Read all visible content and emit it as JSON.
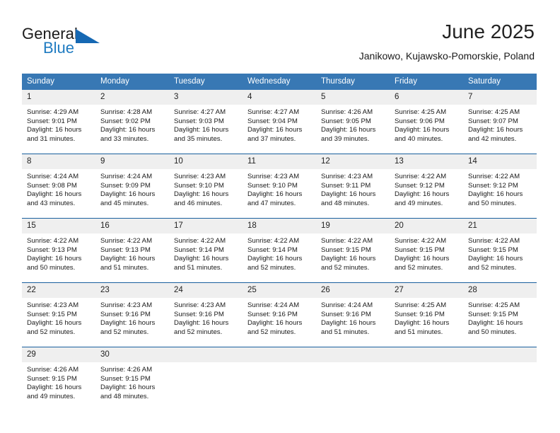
{
  "brand": {
    "name_part1": "General",
    "name_part2": "Blue",
    "accent_color": "#1668b3"
  },
  "header": {
    "title": "June 2025",
    "subtitle": "Janikowo, Kujawsko-Pomorskie, Poland"
  },
  "theme": {
    "header_row_bg": "#3878b4",
    "date_band_bg": "#efefef",
    "row_divider": "#195f9e"
  },
  "weekdays": [
    "Sunday",
    "Monday",
    "Tuesday",
    "Wednesday",
    "Thursday",
    "Friday",
    "Saturday"
  ],
  "weeks": [
    {
      "days": [
        {
          "date": "1",
          "sunrise": "Sunrise: 4:29 AM",
          "sunset": "Sunset: 9:01 PM",
          "daylight_line1": "Daylight: 16 hours",
          "daylight_line2": "and 31 minutes."
        },
        {
          "date": "2",
          "sunrise": "Sunrise: 4:28 AM",
          "sunset": "Sunset: 9:02 PM",
          "daylight_line1": "Daylight: 16 hours",
          "daylight_line2": "and 33 minutes."
        },
        {
          "date": "3",
          "sunrise": "Sunrise: 4:27 AM",
          "sunset": "Sunset: 9:03 PM",
          "daylight_line1": "Daylight: 16 hours",
          "daylight_line2": "and 35 minutes."
        },
        {
          "date": "4",
          "sunrise": "Sunrise: 4:27 AM",
          "sunset": "Sunset: 9:04 PM",
          "daylight_line1": "Daylight: 16 hours",
          "daylight_line2": "and 37 minutes."
        },
        {
          "date": "5",
          "sunrise": "Sunrise: 4:26 AM",
          "sunset": "Sunset: 9:05 PM",
          "daylight_line1": "Daylight: 16 hours",
          "daylight_line2": "and 39 minutes."
        },
        {
          "date": "6",
          "sunrise": "Sunrise: 4:25 AM",
          "sunset": "Sunset: 9:06 PM",
          "daylight_line1": "Daylight: 16 hours",
          "daylight_line2": "and 40 minutes."
        },
        {
          "date": "7",
          "sunrise": "Sunrise: 4:25 AM",
          "sunset": "Sunset: 9:07 PM",
          "daylight_line1": "Daylight: 16 hours",
          "daylight_line2": "and 42 minutes."
        }
      ]
    },
    {
      "days": [
        {
          "date": "8",
          "sunrise": "Sunrise: 4:24 AM",
          "sunset": "Sunset: 9:08 PM",
          "daylight_line1": "Daylight: 16 hours",
          "daylight_line2": "and 43 minutes."
        },
        {
          "date": "9",
          "sunrise": "Sunrise: 4:24 AM",
          "sunset": "Sunset: 9:09 PM",
          "daylight_line1": "Daylight: 16 hours",
          "daylight_line2": "and 45 minutes."
        },
        {
          "date": "10",
          "sunrise": "Sunrise: 4:23 AM",
          "sunset": "Sunset: 9:10 PM",
          "daylight_line1": "Daylight: 16 hours",
          "daylight_line2": "and 46 minutes."
        },
        {
          "date": "11",
          "sunrise": "Sunrise: 4:23 AM",
          "sunset": "Sunset: 9:10 PM",
          "daylight_line1": "Daylight: 16 hours",
          "daylight_line2": "and 47 minutes."
        },
        {
          "date": "12",
          "sunrise": "Sunrise: 4:23 AM",
          "sunset": "Sunset: 9:11 PM",
          "daylight_line1": "Daylight: 16 hours",
          "daylight_line2": "and 48 minutes."
        },
        {
          "date": "13",
          "sunrise": "Sunrise: 4:22 AM",
          "sunset": "Sunset: 9:12 PM",
          "daylight_line1": "Daylight: 16 hours",
          "daylight_line2": "and 49 minutes."
        },
        {
          "date": "14",
          "sunrise": "Sunrise: 4:22 AM",
          "sunset": "Sunset: 9:12 PM",
          "daylight_line1": "Daylight: 16 hours",
          "daylight_line2": "and 50 minutes."
        }
      ]
    },
    {
      "days": [
        {
          "date": "15",
          "sunrise": "Sunrise: 4:22 AM",
          "sunset": "Sunset: 9:13 PM",
          "daylight_line1": "Daylight: 16 hours",
          "daylight_line2": "and 50 minutes."
        },
        {
          "date": "16",
          "sunrise": "Sunrise: 4:22 AM",
          "sunset": "Sunset: 9:13 PM",
          "daylight_line1": "Daylight: 16 hours",
          "daylight_line2": "and 51 minutes."
        },
        {
          "date": "17",
          "sunrise": "Sunrise: 4:22 AM",
          "sunset": "Sunset: 9:14 PM",
          "daylight_line1": "Daylight: 16 hours",
          "daylight_line2": "and 51 minutes."
        },
        {
          "date": "18",
          "sunrise": "Sunrise: 4:22 AM",
          "sunset": "Sunset: 9:14 PM",
          "daylight_line1": "Daylight: 16 hours",
          "daylight_line2": "and 52 minutes."
        },
        {
          "date": "19",
          "sunrise": "Sunrise: 4:22 AM",
          "sunset": "Sunset: 9:15 PM",
          "daylight_line1": "Daylight: 16 hours",
          "daylight_line2": "and 52 minutes."
        },
        {
          "date": "20",
          "sunrise": "Sunrise: 4:22 AM",
          "sunset": "Sunset: 9:15 PM",
          "daylight_line1": "Daylight: 16 hours",
          "daylight_line2": "and 52 minutes."
        },
        {
          "date": "21",
          "sunrise": "Sunrise: 4:22 AM",
          "sunset": "Sunset: 9:15 PM",
          "daylight_line1": "Daylight: 16 hours",
          "daylight_line2": "and 52 minutes."
        }
      ]
    },
    {
      "days": [
        {
          "date": "22",
          "sunrise": "Sunrise: 4:23 AM",
          "sunset": "Sunset: 9:15 PM",
          "daylight_line1": "Daylight: 16 hours",
          "daylight_line2": "and 52 minutes."
        },
        {
          "date": "23",
          "sunrise": "Sunrise: 4:23 AM",
          "sunset": "Sunset: 9:16 PM",
          "daylight_line1": "Daylight: 16 hours",
          "daylight_line2": "and 52 minutes."
        },
        {
          "date": "24",
          "sunrise": "Sunrise: 4:23 AM",
          "sunset": "Sunset: 9:16 PM",
          "daylight_line1": "Daylight: 16 hours",
          "daylight_line2": "and 52 minutes."
        },
        {
          "date": "25",
          "sunrise": "Sunrise: 4:24 AM",
          "sunset": "Sunset: 9:16 PM",
          "daylight_line1": "Daylight: 16 hours",
          "daylight_line2": "and 52 minutes."
        },
        {
          "date": "26",
          "sunrise": "Sunrise: 4:24 AM",
          "sunset": "Sunset: 9:16 PM",
          "daylight_line1": "Daylight: 16 hours",
          "daylight_line2": "and 51 minutes."
        },
        {
          "date": "27",
          "sunrise": "Sunrise: 4:25 AM",
          "sunset": "Sunset: 9:16 PM",
          "daylight_line1": "Daylight: 16 hours",
          "daylight_line2": "and 51 minutes."
        },
        {
          "date": "28",
          "sunrise": "Sunrise: 4:25 AM",
          "sunset": "Sunset: 9:15 PM",
          "daylight_line1": "Daylight: 16 hours",
          "daylight_line2": "and 50 minutes."
        }
      ]
    },
    {
      "days": [
        {
          "date": "29",
          "sunrise": "Sunrise: 4:26 AM",
          "sunset": "Sunset: 9:15 PM",
          "daylight_line1": "Daylight: 16 hours",
          "daylight_line2": "and 49 minutes."
        },
        {
          "date": "30",
          "sunrise": "Sunrise: 4:26 AM",
          "sunset": "Sunset: 9:15 PM",
          "daylight_line1": "Daylight: 16 hours",
          "daylight_line2": "and 48 minutes."
        },
        {
          "date": "",
          "sunrise": "",
          "sunset": "",
          "daylight_line1": "",
          "daylight_line2": ""
        },
        {
          "date": "",
          "sunrise": "",
          "sunset": "",
          "daylight_line1": "",
          "daylight_line2": ""
        },
        {
          "date": "",
          "sunrise": "",
          "sunset": "",
          "daylight_line1": "",
          "daylight_line2": ""
        },
        {
          "date": "",
          "sunrise": "",
          "sunset": "",
          "daylight_line1": "",
          "daylight_line2": ""
        },
        {
          "date": "",
          "sunrise": "",
          "sunset": "",
          "daylight_line1": "",
          "daylight_line2": ""
        }
      ]
    }
  ]
}
